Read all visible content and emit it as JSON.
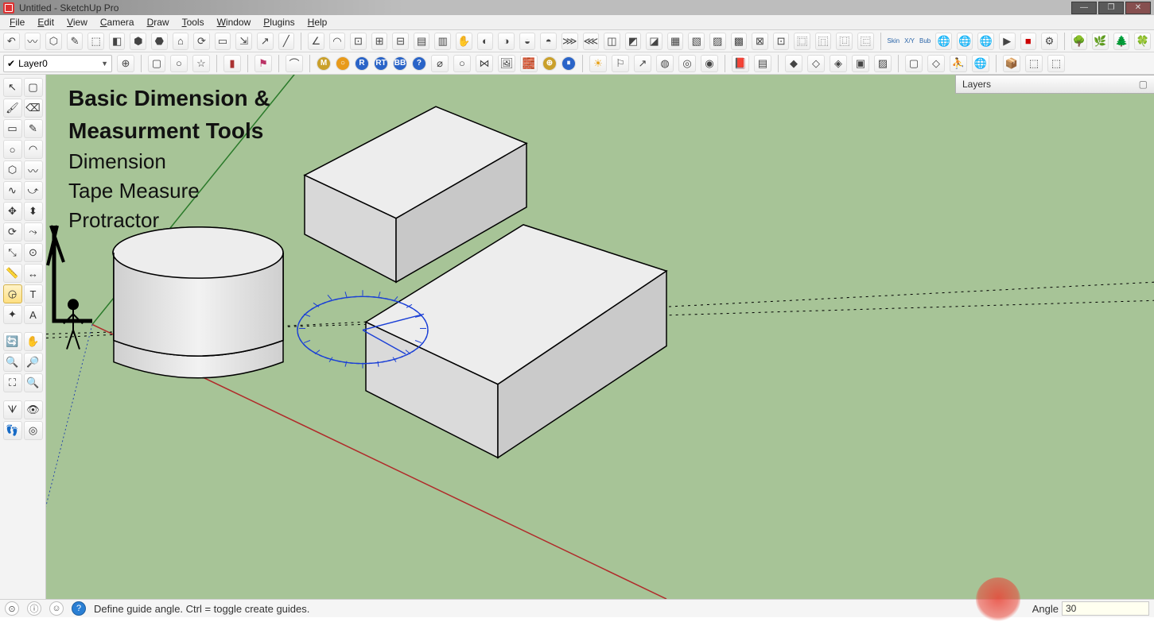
{
  "titlebar": {
    "title": "Untitled - SketchUp Pro"
  },
  "menu": [
    "File",
    "Edit",
    "View",
    "Camera",
    "Draw",
    "Tools",
    "Window",
    "Plugins",
    "Help"
  ],
  "topRow1": {
    "mini_labels": [
      "Skin",
      "X/Y",
      "Bub"
    ]
  },
  "layer": {
    "name": "Layer0"
  },
  "layers_panel": {
    "title": "Layers"
  },
  "overlay": {
    "heading1": "Basic Dimension &",
    "heading2": "Measurment Tools",
    "line1": "Dimension",
    "line2": "Tape Measure",
    "line3": "Protractor"
  },
  "status": {
    "hint": "Define guide angle.  Ctrl = toggle create guides.",
    "angle_label": "Angle",
    "angle_value": "30"
  }
}
